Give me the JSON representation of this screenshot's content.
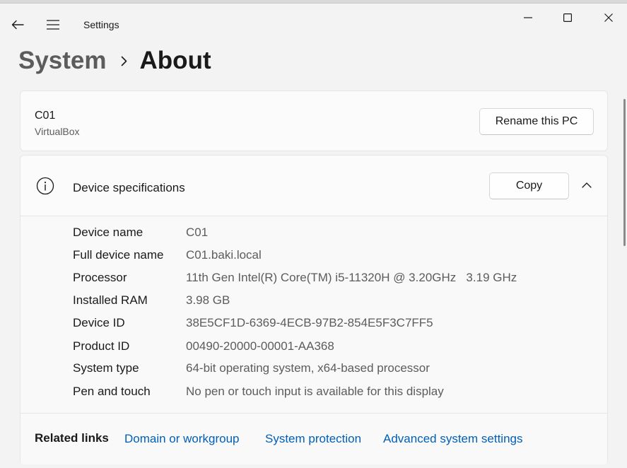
{
  "window": {
    "title": "Settings",
    "minimize_icon": "minimize-icon",
    "maximize_icon": "maximize-icon",
    "close_icon": "close-icon"
  },
  "nav": {
    "back_icon": "back-arrow-icon",
    "menu_icon": "hamburger-menu-icon"
  },
  "breadcrumb": {
    "parent": "System",
    "current": "About"
  },
  "pc": {
    "name": "C01",
    "model": "VirtualBox",
    "rename_label": "Rename this PC"
  },
  "specs": {
    "title": "Device specifications",
    "copy_label": "Copy",
    "icon": "info-icon",
    "rows": [
      {
        "label": "Device name",
        "value": "C01"
      },
      {
        "label": "Full device name",
        "value": "C01.baki.local"
      },
      {
        "label": "Processor",
        "value": "11th Gen Intel(R) Core(TM) i5-11320H @ 3.20GHz   3.19 GHz"
      },
      {
        "label": "Installed RAM",
        "value": "3.98 GB"
      },
      {
        "label": "Device ID",
        "value": "38E5CF1D-6369-4ECB-97B2-854E5F3C7FF5"
      },
      {
        "label": "Product ID",
        "value": "00490-20000-00001-AA368"
      },
      {
        "label": "System type",
        "value": "64-bit operating system, x64-based processor"
      },
      {
        "label": "Pen and touch",
        "value": "No pen or touch input is available for this display"
      }
    ]
  },
  "related": {
    "heading": "Related links",
    "links": [
      "Domain or workgroup",
      "System protection",
      "Advanced system settings"
    ]
  },
  "colors": {
    "accent": "#005fb8",
    "background": "#f3f3f3",
    "card": "#fbfbfb"
  }
}
